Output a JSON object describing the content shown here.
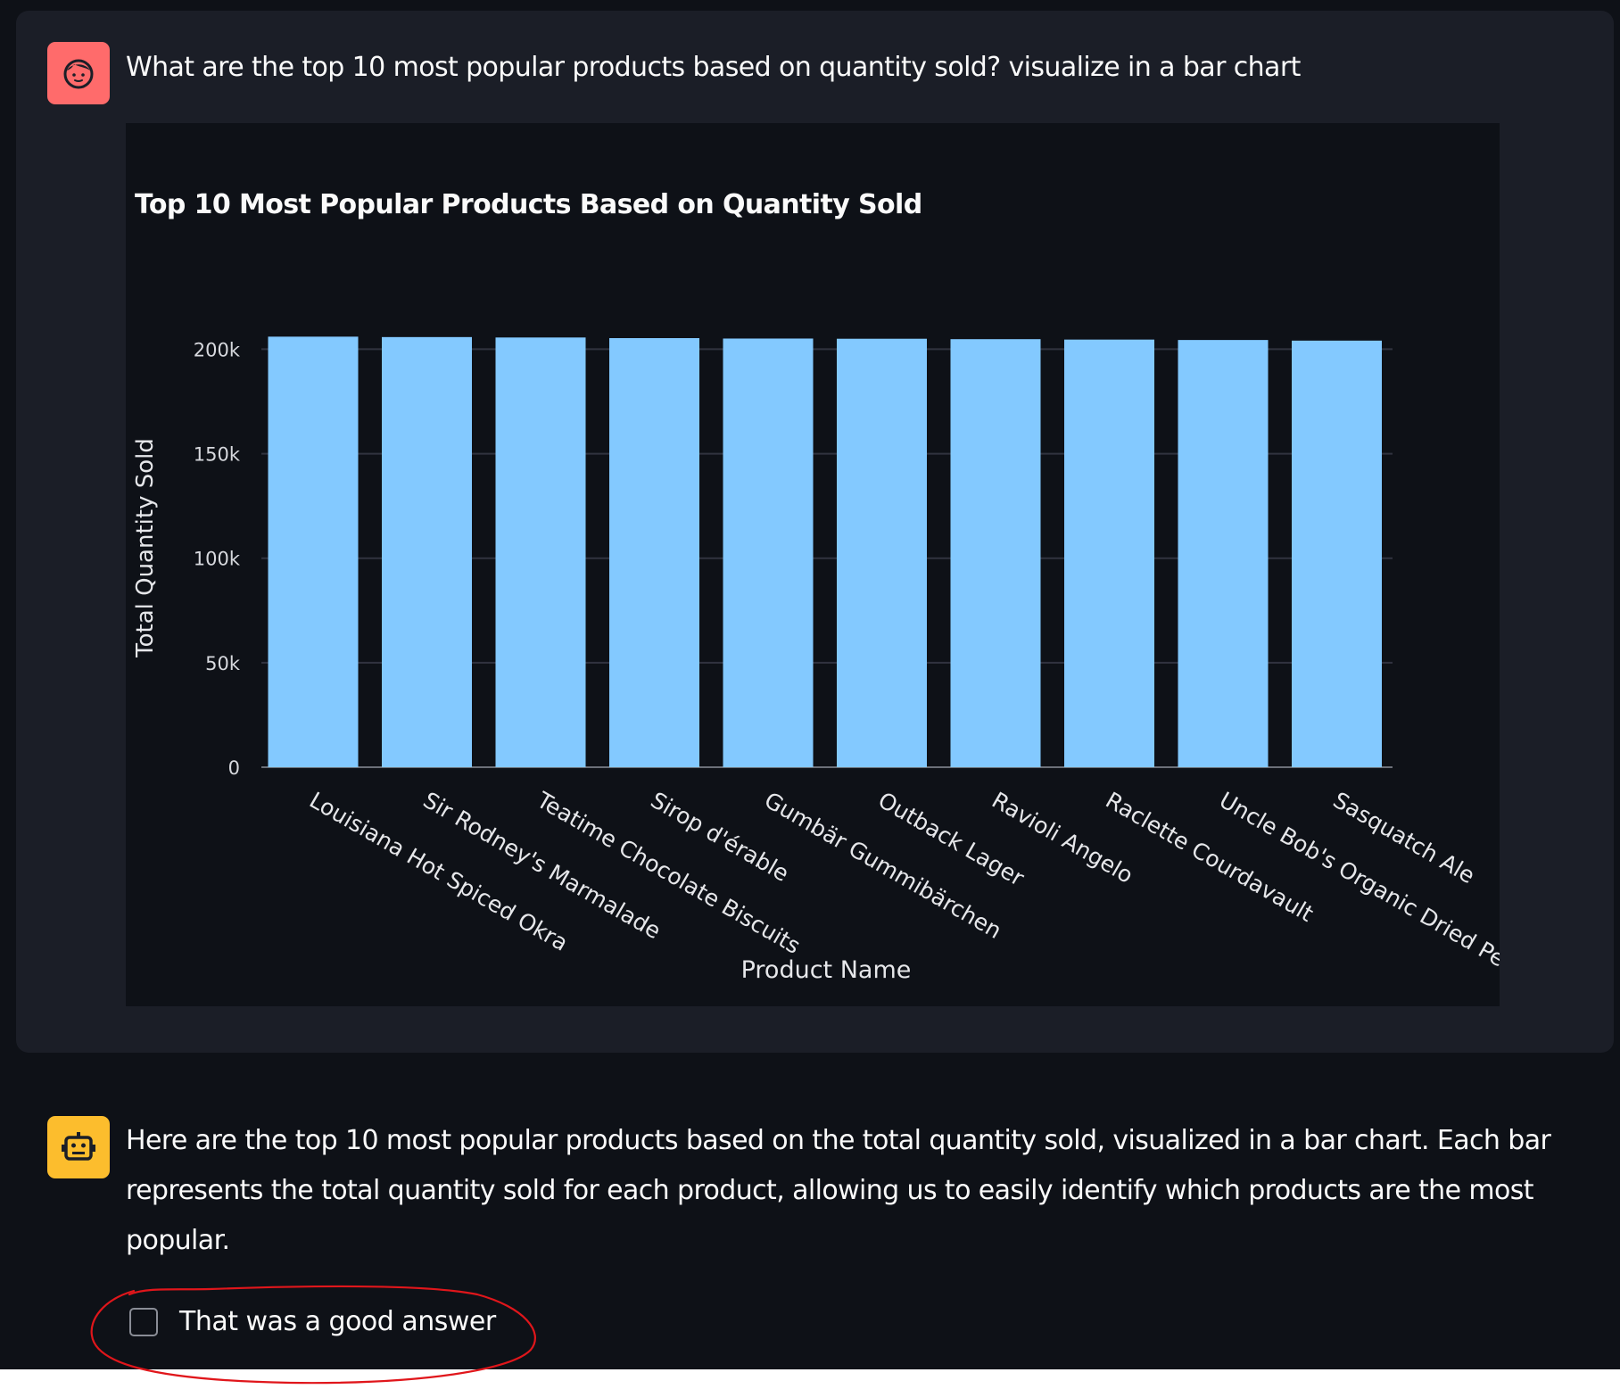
{
  "user_message": {
    "text": "What are the top 10 most popular products based on quantity sold? visualize in a bar chart",
    "avatar_icon": "user-face-icon",
    "avatar_color": "#ff6b6b"
  },
  "chart_data": {
    "type": "bar",
    "title": "Top 10 Most Popular Products Based on Quantity Sold",
    "xlabel": "Product Name",
    "ylabel": "Total Quantity Sold",
    "categories": [
      "Louisiana Hot Spiced Okra",
      "Sir Rodney's Marmalade",
      "Teatime Chocolate Biscuits",
      "Sirop d'érable",
      "Gumbär Gummibärchen",
      "Outback Lager",
      "Ravioli Angelo",
      "Raclette Courdavault",
      "Uncle Bob's Organic Dried Pears",
      "Sasquatch Ale"
    ],
    "values": [
      206000,
      205800,
      205600,
      205300,
      205100,
      205000,
      204800,
      204600,
      204400,
      204100
    ],
    "ylim": [
      0,
      210000
    ],
    "yticks": [
      0,
      50000,
      100000,
      150000,
      200000
    ],
    "ytick_labels": [
      "0",
      "50k",
      "100k",
      "150k",
      "200k"
    ],
    "grid": true,
    "bar_color": "#83c9ff"
  },
  "assistant_message": {
    "text": "Here are the top 10 most popular products based on the total quantity sold, visualized in a bar chart. Each bar represents the total quantity sold for each product, allowing us to easily identify which products are the most popular.",
    "avatar_icon": "robot-icon",
    "avatar_color": "#fcbd2d"
  },
  "feedback": {
    "label": "That was a good answer",
    "checked": false
  },
  "annotation_color": "#e0161b"
}
